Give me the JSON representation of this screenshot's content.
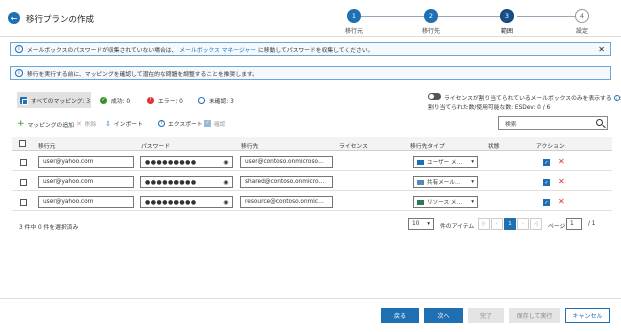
{
  "header": {
    "title": "移行プランの作成",
    "back_icon": "arrow-left-icon"
  },
  "stepper": [
    {
      "num": "1",
      "label": "移行元",
      "state": "done"
    },
    {
      "num": "2",
      "label": "移行先",
      "state": "done"
    },
    {
      "num": "3",
      "label": "範囲",
      "state": "current"
    },
    {
      "num": "4",
      "label": "設定",
      "state": "todo"
    }
  ],
  "info1": {
    "text_before": "メールボックスのパスワードが収集されていない場合は、",
    "link": "メールボックス マネージャー",
    "text_after": "に移動してパスワードを収集してください。"
  },
  "info2": {
    "text": "移行を実行する前に、マッピングを確認して潜在的な問題を調整することを推奨します。"
  },
  "filters": {
    "all": "すべてのマッピング: 3",
    "success": "成功: 0",
    "error": "エラー: 0",
    "unconfirmed": "未確認: 3"
  },
  "license": {
    "toggle_label": "ライセンスが割り当てられているメールボックスのみを表示する",
    "toggle_suffix": ":6",
    "assigned": "割り当てられた数/使用可能な数: ESDev: 0 / 6"
  },
  "toolbar": {
    "add": "マッピングの追加",
    "delete": "削除",
    "import": "インポート",
    "export": "エクスポート",
    "confirm": "確認",
    "search_placeholder": "検索"
  },
  "table": {
    "headers": [
      "移行元",
      "パスワード",
      "移行先",
      "ライセンス",
      "移行先タイプ",
      "状態",
      "アクション"
    ],
    "rows": [
      {
        "source": "user@yahoo.com",
        "password": "●●●●●●●●●",
        "target": "user@contoso.onmicroso…",
        "license": "",
        "type": "ユーザー メ…",
        "status": ""
      },
      {
        "source": "user@yahoo.com",
        "password": "●●●●●●●●●",
        "target": "shared@contoso.onmicro…",
        "license": "",
        "type": "共有メール…",
        "status": ""
      },
      {
        "source": "user@yahoo.com",
        "password": "●●●●●●●●●",
        "target": "resource@contoso.onmic…",
        "license": "",
        "type": "リソース メ…",
        "status": ""
      }
    ]
  },
  "pagination": {
    "selection": "3 件中 0 件を選択済み",
    "page_size": "10",
    "items_label": "件のアイテム",
    "current_page": "1",
    "page_label": "ページ",
    "page_input": "1",
    "total_pages": "/ 1"
  },
  "buttons": {
    "back": "戻る",
    "next": "次へ",
    "finish": "完了",
    "save_run": "保存して実行",
    "cancel": "キャンセル"
  },
  "colors": {
    "accent": "#1f6fb3",
    "error": "#d33333",
    "success": "#3a8f2d"
  }
}
